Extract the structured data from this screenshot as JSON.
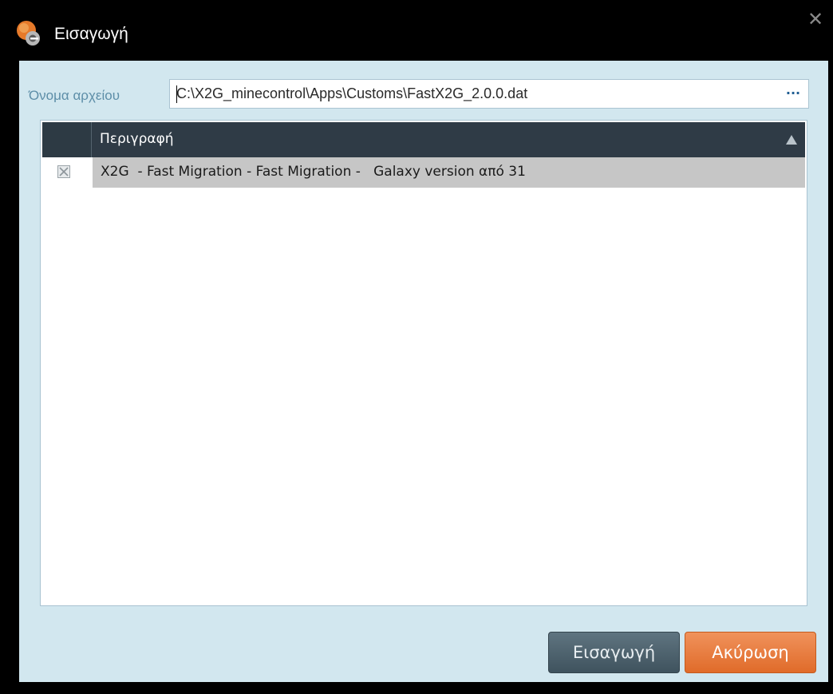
{
  "window": {
    "title": "Εισαγωγή",
    "app_icon": "app-logo-icon",
    "close_glyph": "✕"
  },
  "file": {
    "label": "Όνομα αρχείου",
    "value": "C:\\X2G_minecontrol\\Apps\\Customs\\FastX2G_2.0.0.dat",
    "browse_glyph": "···"
  },
  "grid": {
    "columns": [
      "",
      "Περιγραφή"
    ],
    "sort_direction": "ascending",
    "rows": [
      {
        "checked": false,
        "description": "X2G  - Fast Migration - Fast Migration -   Galaxy version από 31"
      }
    ]
  },
  "buttons": {
    "import_label": "Εισαγωγή",
    "cancel_label": "Ακύρωση"
  },
  "colors": {
    "client_bg": "#d2e7ef",
    "header_bg": "#2f3b46",
    "selected_row": "#c6c6c6",
    "cancel_accent": "#e97a3a"
  }
}
